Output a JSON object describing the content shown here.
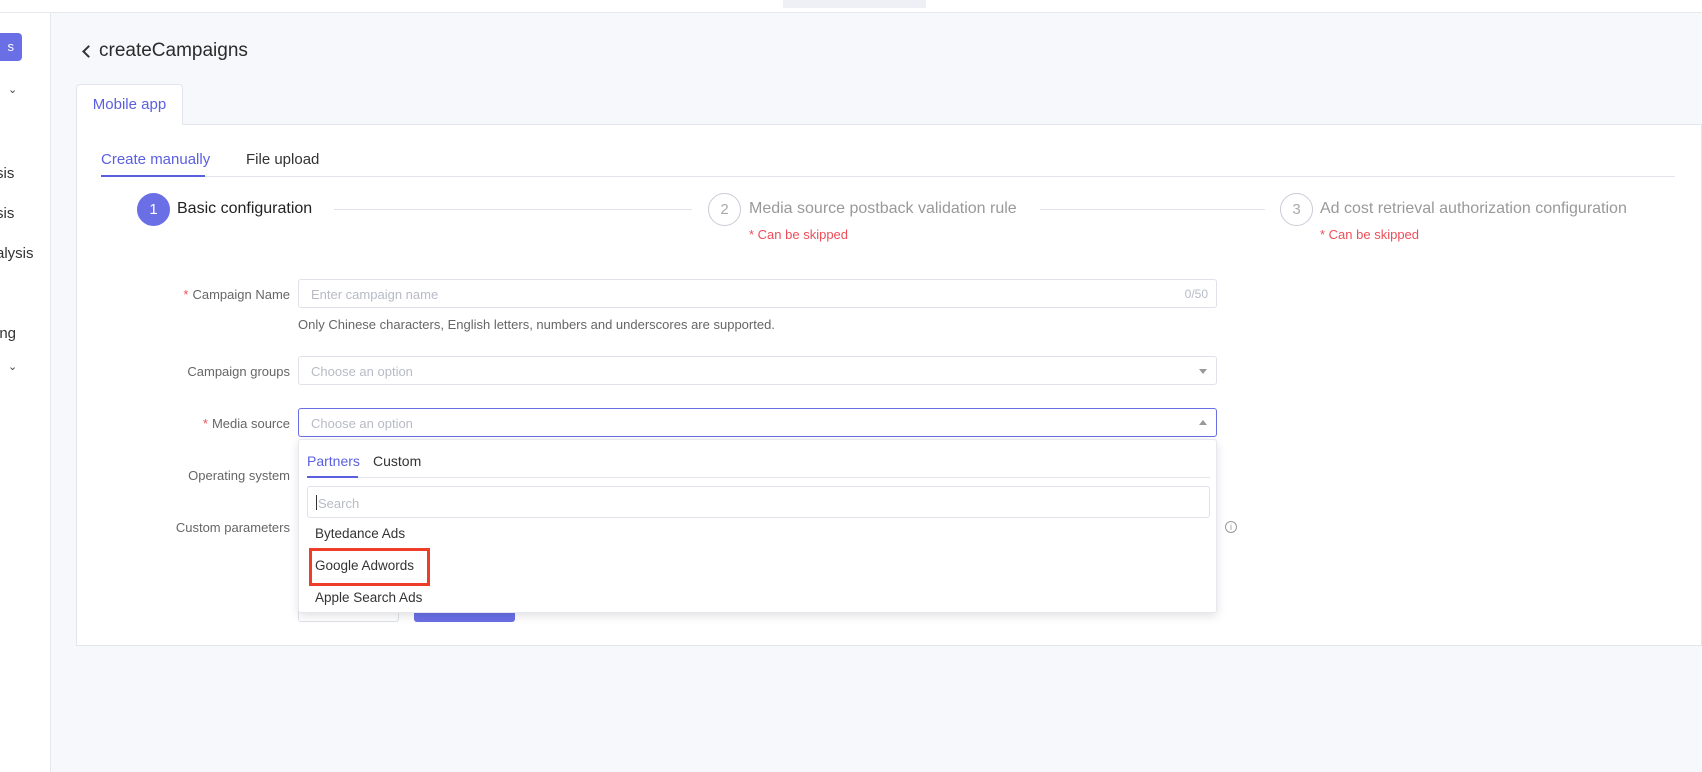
{
  "sidebar": {
    "top_button_label": "s",
    "items": [
      {
        "label": "sis"
      },
      {
        "label": "sis"
      },
      {
        "label": "alysis"
      },
      {
        "label": "ing"
      }
    ]
  },
  "header": {
    "title": "createCampaigns"
  },
  "app_tab": {
    "label": "Mobile app"
  },
  "subtabs": [
    {
      "label": "Create manually",
      "active": true
    },
    {
      "label": "File upload",
      "active": false
    }
  ],
  "steps": [
    {
      "number": "1",
      "title": "Basic configuration",
      "note": "",
      "active": true
    },
    {
      "number": "2",
      "title": "Media source postback validation rule",
      "note": "* Can be skipped",
      "active": false
    },
    {
      "number": "3",
      "title": "Ad cost retrieval authorization configuration",
      "note": "* Can be skipped",
      "active": false
    }
  ],
  "form": {
    "campaign_name": {
      "label": "Campaign Name",
      "required_mark": "*",
      "placeholder": "Enter campaign name",
      "count": "0/50",
      "hint": "Only Chinese characters, English letters, numbers and underscores are supported."
    },
    "campaign_groups": {
      "label": "Campaign groups",
      "placeholder": "Choose an option"
    },
    "media_source": {
      "label": "Media source",
      "required_mark": "*",
      "placeholder": "Choose an option"
    },
    "operating_system": {
      "label": "Operating system"
    },
    "custom_parameters": {
      "label": "Custom parameters"
    }
  },
  "dropdown": {
    "tabs": [
      {
        "label": "Partners",
        "active": true
      },
      {
        "label": "Custom",
        "active": false
      }
    ],
    "search_placeholder": "Search",
    "options": [
      {
        "label": "Bytedance Ads"
      },
      {
        "label": "Google Adwords",
        "highlighted": true
      },
      {
        "label": "Apple Search Ads"
      }
    ]
  },
  "colors": {
    "accent": "#6a6fe6",
    "required": "#ee4e5a",
    "highlight_border": "#ee3e2a"
  },
  "icons": {
    "back": "chevron-left-icon",
    "sidebar_expand": "chevron-down-icon",
    "select_caret": "caret-down-icon",
    "info": "info-icon"
  }
}
